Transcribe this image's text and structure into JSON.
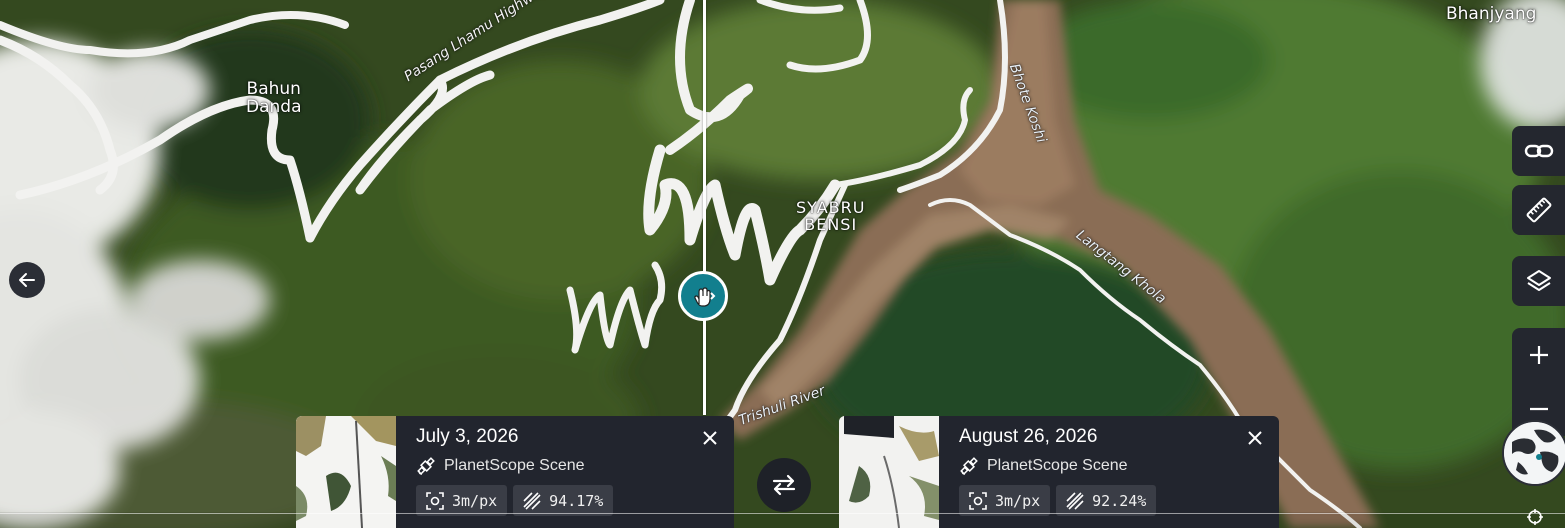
{
  "map": {
    "labels": {
      "bhanjyang": "Bhanjyang",
      "bahun_danda": "Bahun\nDanda",
      "syabru_bensi": "SYABRU\nBENSI",
      "highway": "Pasang Lhamu Highway",
      "bhote_koshi": "Bhote Koshi",
      "langtang_khola": "Langtang Khola",
      "trishuli_river": "Trishuli River"
    }
  },
  "toolbar": {
    "icons": [
      "link-icon",
      "ruler-icon",
      "layers-icon",
      "plus-icon",
      "minus-icon",
      "globe-icon",
      "locate-icon"
    ]
  },
  "compare": {
    "left": {
      "date": "July 3, 2026",
      "source": "PlanetScope Scene",
      "resolution": "3m/px",
      "coverage": "94.17%"
    },
    "right": {
      "date": "August 26, 2026",
      "source": "PlanetScope Scene",
      "resolution": "3m/px",
      "coverage": "92.24%"
    }
  },
  "colors": {
    "accent": "#127f8e",
    "panel": "#22252e",
    "chip": "#3a3d46"
  }
}
